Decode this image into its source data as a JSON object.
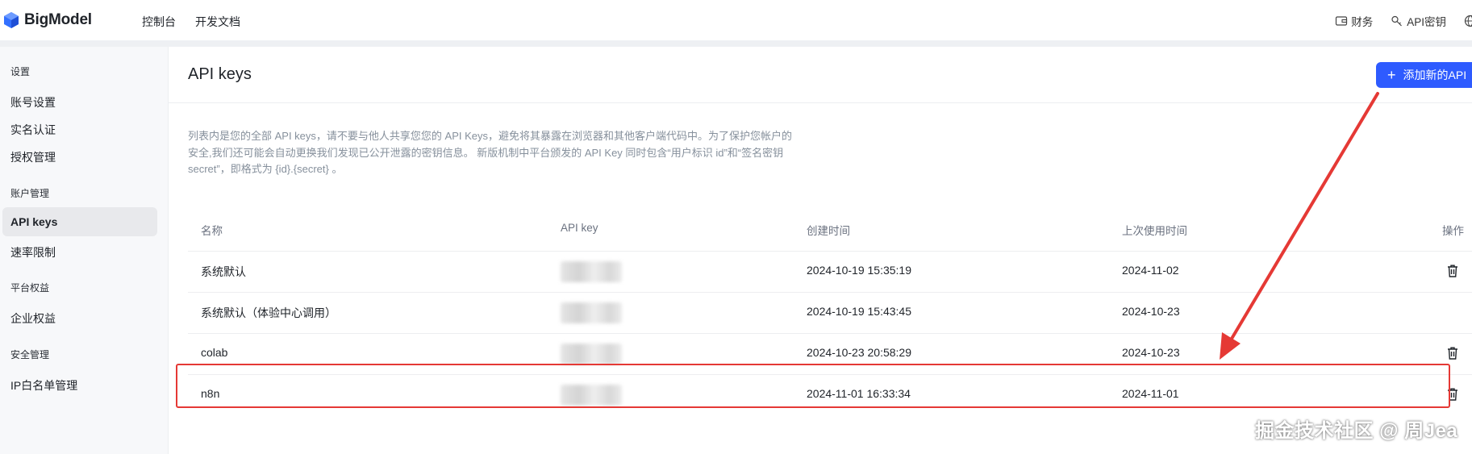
{
  "brand": {
    "name": "BigModel",
    "accent": "#3370ff"
  },
  "topnav": {
    "items": [
      "控制台",
      "开发文档"
    ]
  },
  "topright": {
    "finance": "财务",
    "apikey": "API密钥"
  },
  "sidebar": {
    "groups": [
      {
        "title": "设置",
        "items": [
          "账号设置",
          "实名认证",
          "授权管理"
        ]
      },
      {
        "title": "账户管理",
        "items": [
          "API keys",
          "速率限制"
        ]
      },
      {
        "title": "平台权益",
        "items": [
          "企业权益"
        ]
      },
      {
        "title": "安全管理",
        "items": [
          "IP白名单管理"
        ]
      }
    ],
    "active": "API keys"
  },
  "main": {
    "title": "API keys",
    "add_button": "添加新的API",
    "description": "列表内是您的全部 API keys，请不要与他人共享您您的 API Keys，避免将其暴露在浏览器和其他客户端代码中。为了保护您帐户的安全,我们还可能会自动更换我们发现已公开泄露的密钥信息。 新版机制中平台颁发的 API Key 同时包含“用户标识 id”和“签名密钥 secret”，即格式为 {id}.{secret} 。",
    "table": {
      "headers": [
        "名称",
        "API key",
        "创建时间",
        "上次使用时间",
        "操作"
      ],
      "rows": [
        {
          "name": "系统默认",
          "created": "2024-10-19 15:35:19",
          "last_used": "2024-11-02",
          "deletable": true
        },
        {
          "name": "系统默认（体验中心调用）",
          "created": "2024-10-19 15:43:45",
          "last_used": "2024-10-23",
          "deletable": false
        },
        {
          "name": "colab",
          "created": "2024-10-23 20:58:29",
          "last_used": "2024-10-23",
          "deletable": true
        },
        {
          "name": "n8n",
          "created": "2024-11-01 16:33:34",
          "last_used": "2024-11-01",
          "deletable": true
        }
      ]
    }
  },
  "watermark": "掘金技术社区 @ 周Jea",
  "colors": {
    "primary": "#2e5bff",
    "annotation": "#e53935"
  }
}
